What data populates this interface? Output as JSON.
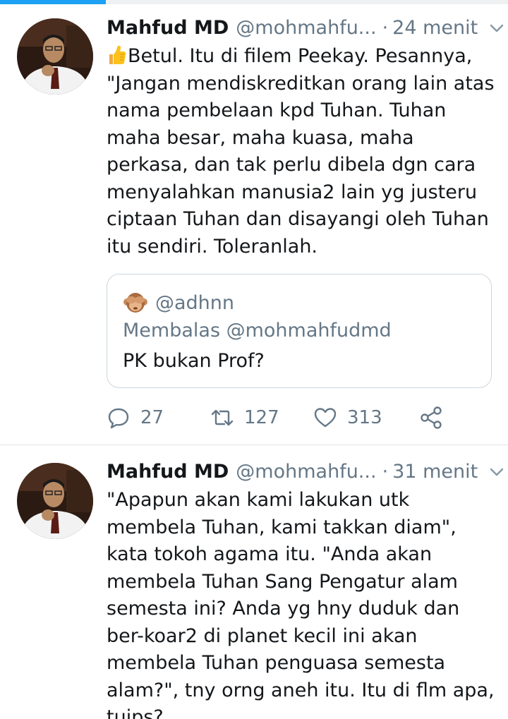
{
  "tweets": [
    {
      "author_name": "Mahfud MD",
      "handle": "@mohmahfu...",
      "separator": "·",
      "time": "24 menit",
      "text": "Betul. Itu di filem Peekay. Pesannya, \"Jangan mendiskreditkan orang lain atas nama pembelaan kpd Tuhan. Tuhan maha besar, maha kuasa, maha perkasa, dan tak perlu dibela dgn cara menyalahkan manusia2 lain yg justeru ciptaan Tuhan dan disayangi oleh Tuhan itu sendiri. Toleranlah.",
      "lead_icon": "thumbs-up-emoji",
      "quoted": {
        "icon": "see-no-evil-monkey-emoji",
        "user": "@adhnn",
        "reply_to": "Membalas @mohmahfudmd",
        "text": "PK bukan Prof?"
      },
      "replies": "27",
      "retweets": "127",
      "likes": "313"
    },
    {
      "author_name": "Mahfud MD",
      "handle": "@mohmahfu...",
      "separator": "·",
      "time": "31 menit",
      "text": "\"Apapun akan kami lakukan utk membela Tuhan, kami takkan diam\", kata tokoh agama itu. \"Anda akan membela Tuhan Sang Pengatur alam semesta ini? Anda yg hny duduk dan ber-koar2 di planet kecil ini akan membela Tuhan penguasa semesta alam?\", tny orng aneh itu. Itu di flm apa, tuips?"
    }
  ],
  "colors": {
    "accent": "#1da1f2",
    "muted": "#657786",
    "text": "#14171a",
    "border": "#ccd6dd"
  }
}
